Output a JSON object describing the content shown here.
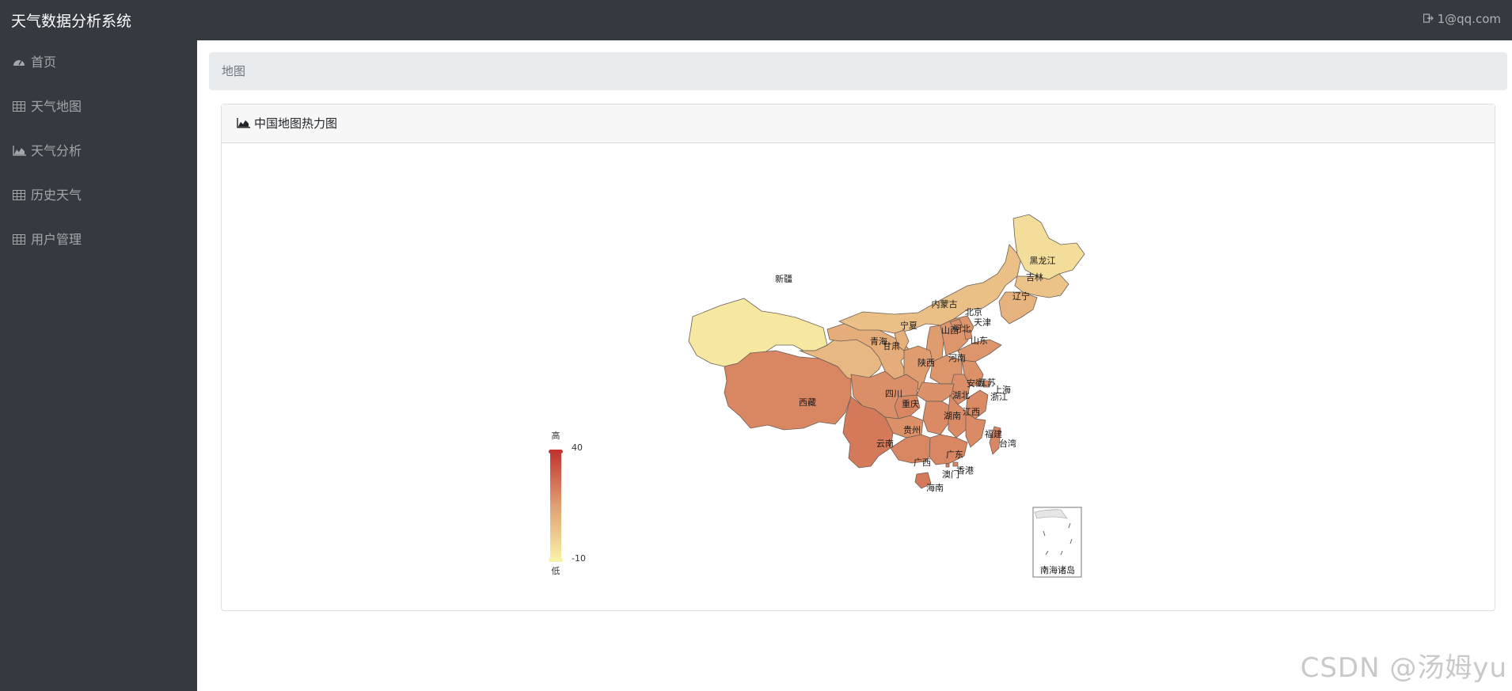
{
  "app": {
    "title": "天气数据分析系统",
    "user": "1@qq.com"
  },
  "sidebar": {
    "items": [
      {
        "label": "首页",
        "icon": "dashboard-icon"
      },
      {
        "label": "天气地图",
        "icon": "table-icon"
      },
      {
        "label": "天气分析",
        "icon": "area-chart-icon"
      },
      {
        "label": "历史天气",
        "icon": "table-icon"
      },
      {
        "label": "用户管理",
        "icon": "table-icon"
      }
    ]
  },
  "breadcrumb": "地图",
  "card": {
    "title": "中国地图热力图"
  },
  "visual_map": {
    "max": "40",
    "min": "-10",
    "high_label": "高",
    "low_label": "低",
    "color_high": "#c23531",
    "color_low": "#f8f0a6"
  },
  "provinces": [
    {
      "name": "新疆",
      "level": 0.05
    },
    {
      "name": "西藏",
      "level": 0.62
    },
    {
      "name": "青海",
      "level": 0.35
    },
    {
      "name": "甘肃",
      "level": 0.42
    },
    {
      "name": "内蒙古",
      "level": 0.3
    },
    {
      "name": "黑龙江",
      "level": 0.12
    },
    {
      "name": "吉林",
      "level": 0.28
    },
    {
      "name": "辽宁",
      "level": 0.38
    },
    {
      "name": "宁夏",
      "level": 0.4
    },
    {
      "name": "山西",
      "level": 0.52
    },
    {
      "name": "河北",
      "level": 0.55
    },
    {
      "name": "北京",
      "level": 0.58
    },
    {
      "name": "天津",
      "level": 0.58
    },
    {
      "name": "山东",
      "level": 0.55
    },
    {
      "name": "陕西",
      "level": 0.52
    },
    {
      "name": "河南",
      "level": 0.55
    },
    {
      "name": "江苏",
      "level": 0.57
    },
    {
      "name": "安徽",
      "level": 0.58
    },
    {
      "name": "上海",
      "level": 0.6
    },
    {
      "name": "浙江",
      "level": 0.6
    },
    {
      "name": "湖北",
      "level": 0.57
    },
    {
      "name": "四川",
      "level": 0.58
    },
    {
      "name": "重庆",
      "level": 0.62
    },
    {
      "name": "湖南",
      "level": 0.6
    },
    {
      "name": "江西",
      "level": 0.6
    },
    {
      "name": "贵州",
      "level": 0.57
    },
    {
      "name": "云南",
      "level": 0.68
    },
    {
      "name": "广西",
      "level": 0.62
    },
    {
      "name": "广东",
      "level": 0.62
    },
    {
      "name": "福建",
      "level": 0.6
    },
    {
      "name": "台湾",
      "level": 0.62
    },
    {
      "name": "香港",
      "level": 0.62
    },
    {
      "name": "澳门",
      "level": 0.62
    },
    {
      "name": "海南",
      "level": 0.68
    }
  ],
  "south_sea_label": "南海诸岛",
  "watermark": "CSDN @汤姆yu"
}
